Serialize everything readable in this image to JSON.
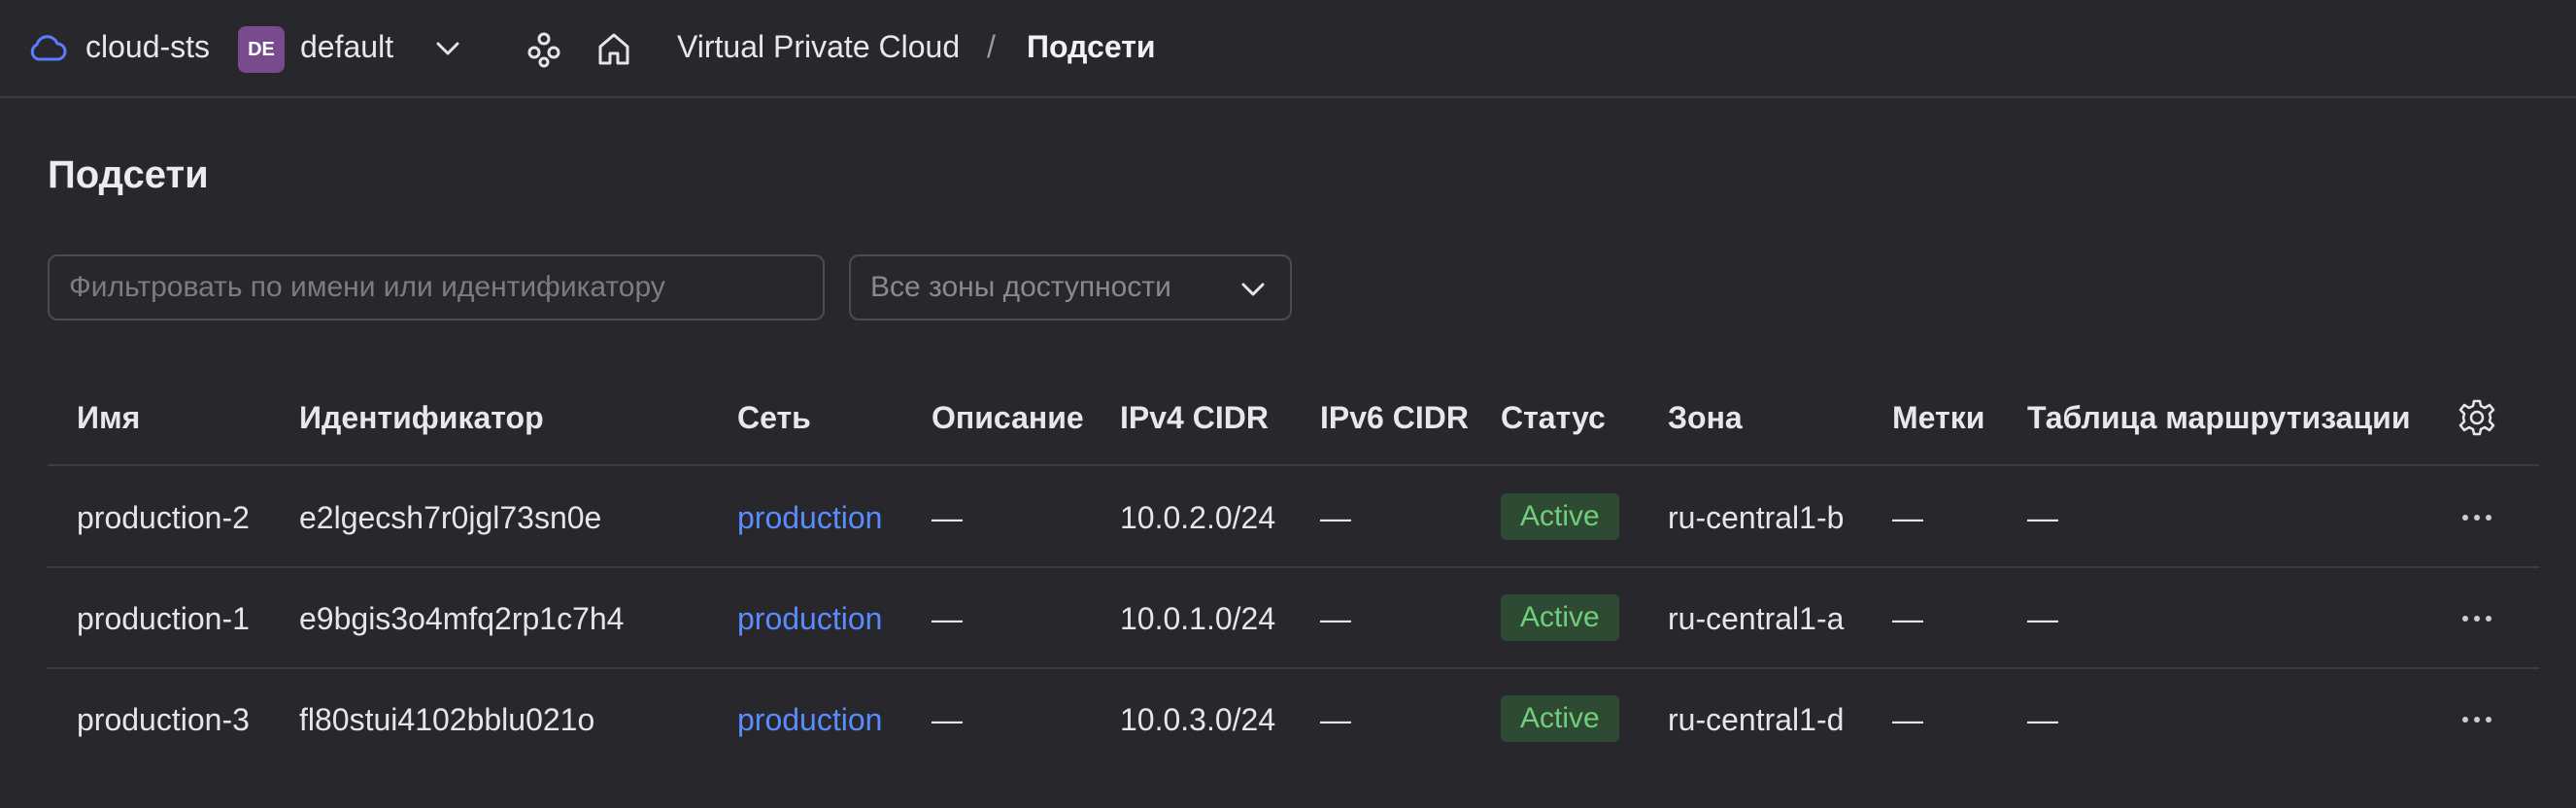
{
  "header": {
    "cloud_name": "cloud-sts",
    "folder_badge": "DE",
    "folder_name": "default",
    "breadcrumb_service": "Virtual Private Cloud",
    "breadcrumb_sep": "/",
    "breadcrumb_current": "Подсети"
  },
  "page": {
    "title": "Подсети"
  },
  "filters": {
    "search_placeholder": "Фильтровать по имени или идентификатору",
    "zone_select": "Все зоны доступности"
  },
  "table": {
    "columns": [
      "Имя",
      "Идентификатор",
      "Сеть",
      "Описание",
      "IPv4 CIDR",
      "IPv6 CIDR",
      "Статус",
      "Зона",
      "Метки",
      "Таблица маршрутизации"
    ],
    "rows": [
      {
        "name": "production-2",
        "id": "e2lgecsh7r0jgl73sn0e",
        "network": "production",
        "description": "—",
        "ipv4": "10.0.2.0/24",
        "ipv6": "—",
        "status": "Active",
        "zone": "ru-central1-b",
        "labels": "—",
        "route_table": "—"
      },
      {
        "name": "production-1",
        "id": "e9bgis3o4mfq2rp1c7h4",
        "network": "production",
        "description": "—",
        "ipv4": "10.0.1.0/24",
        "ipv6": "—",
        "status": "Active",
        "zone": "ru-central1-a",
        "labels": "—",
        "route_table": "—"
      },
      {
        "name": "production-3",
        "id": "fl80stui4102bblu021o",
        "network": "production",
        "description": "—",
        "ipv4": "10.0.3.0/24",
        "ipv6": "—",
        "status": "Active",
        "zone": "ru-central1-d",
        "labels": "—",
        "route_table": "—"
      }
    ]
  },
  "colors": {
    "background": "#28272b",
    "link": "#5a8bff",
    "status_active_bg": "#2f4a33",
    "status_active_text": "#6fcf7a",
    "folder_badge_bg": "#7a4a8f"
  },
  "icons": [
    "cloud-icon",
    "chevron-down-icon",
    "services-icon",
    "home-icon",
    "gear-icon",
    "more-dots-icon"
  ]
}
